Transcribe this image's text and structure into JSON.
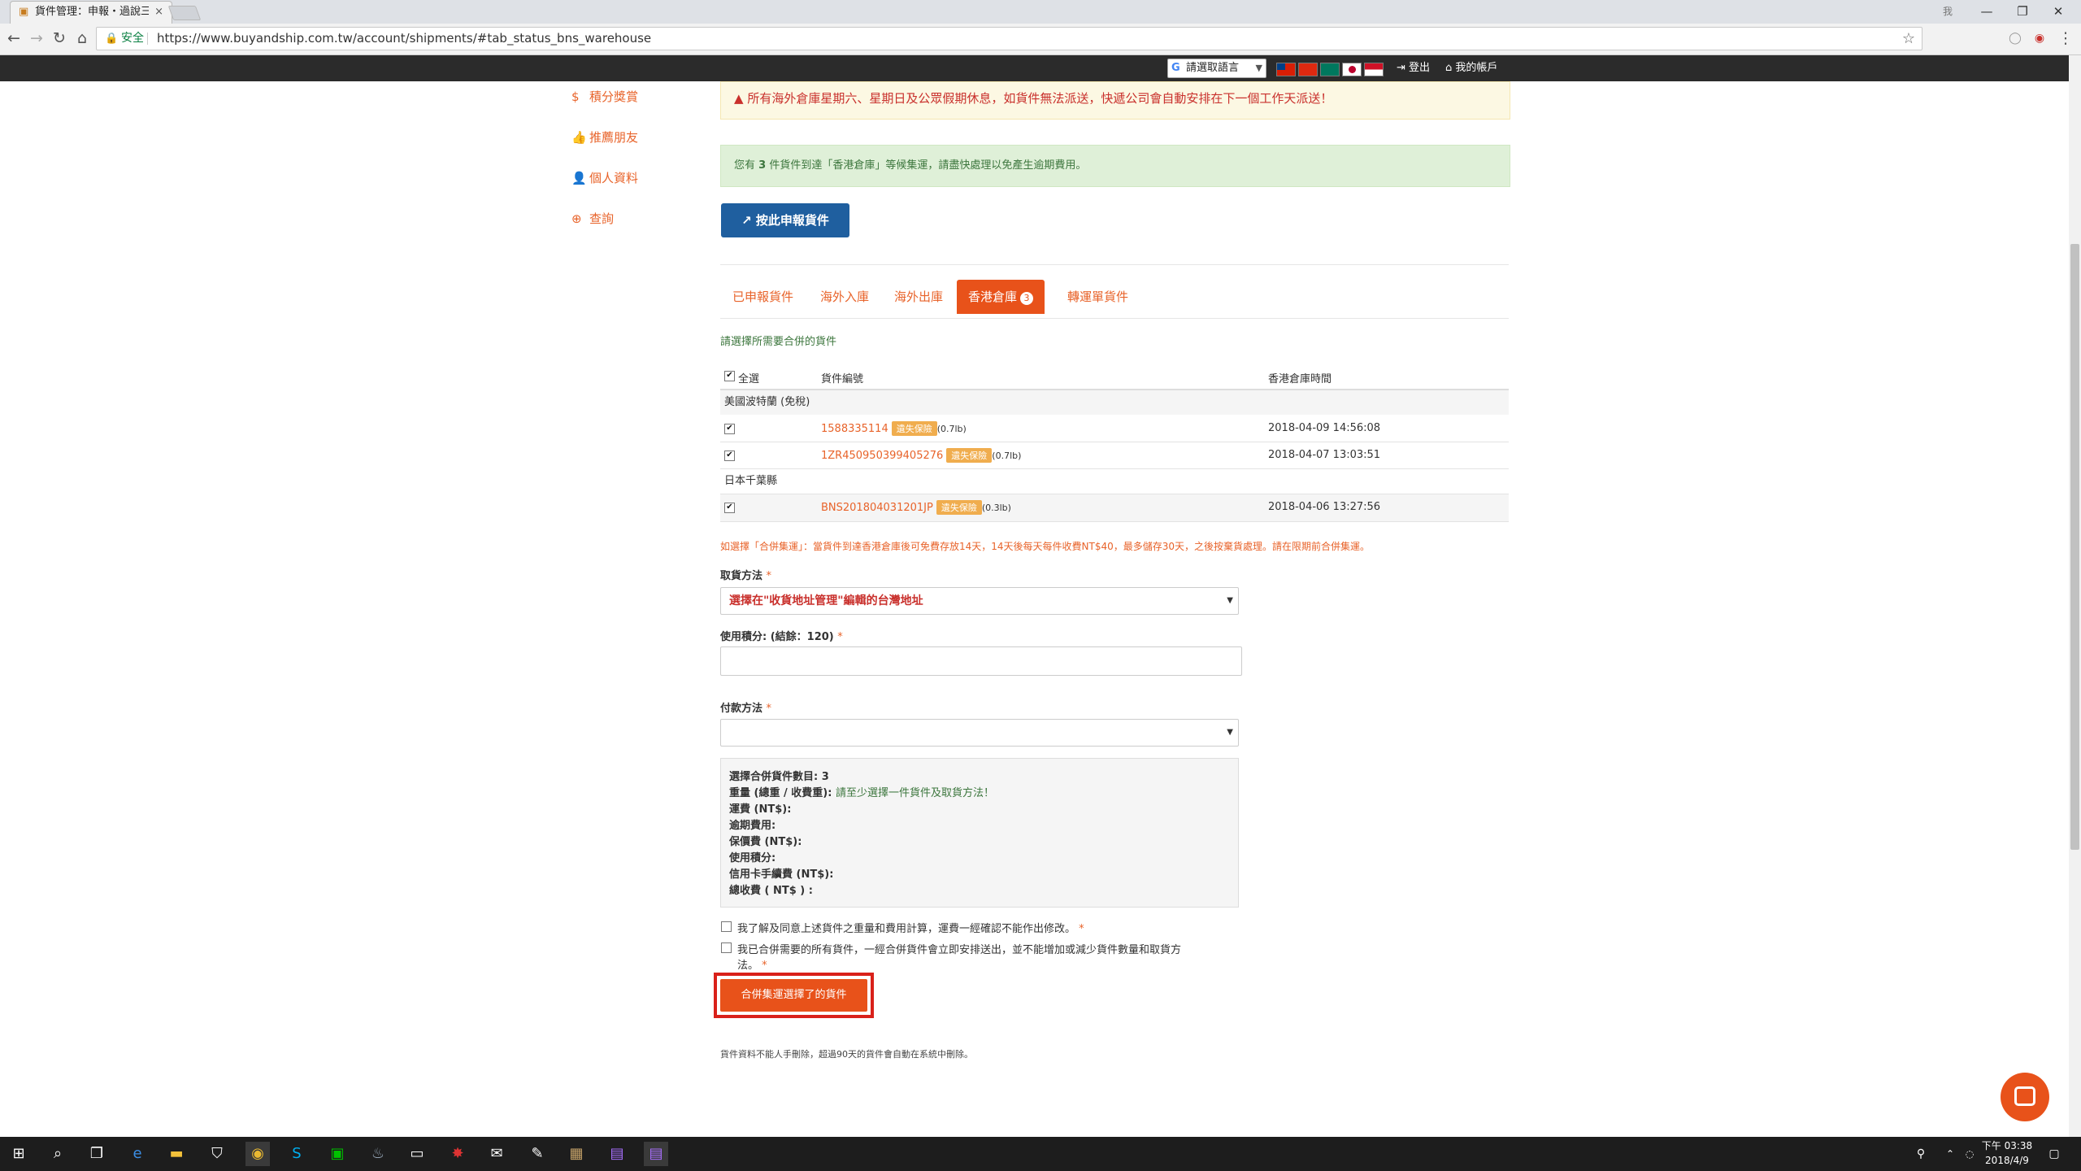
{
  "browser": {
    "tab_title": "貨件管理：申報・過說三",
    "address_secure": "安全",
    "url": "https://www.buyandship.com.tw/account/shipments/#tab_status_bns_warehouse",
    "tab_close": "×",
    "win_user": "我",
    "win_min": "—",
    "win_max": "❐",
    "win_close": "✕"
  },
  "sitebar": {
    "translate_label": "請選取語言",
    "logout": "登出",
    "account": "我的帳戶"
  },
  "sidebar": {
    "items": [
      {
        "icon": "dollar-icon",
        "glyph": "$",
        "label": "積分獎賞"
      },
      {
        "icon": "thumbs-up-icon",
        "glyph": "👍",
        "label": "推薦朋友"
      },
      {
        "icon": "user-icon",
        "glyph": "👤",
        "label": "個人資料"
      },
      {
        "icon": "lifebuoy-icon",
        "glyph": "⊕",
        "label": "查詢"
      }
    ]
  },
  "alerts": {
    "warning": "所有海外倉庫星期六、星期日及公眾假期休息，如貨件無法派送，快遞公司會自動安排在下一個工作天派送！",
    "info_prefix": "您有 ",
    "info_count": "3",
    "info_suffix": " 件貨件到達「香港倉庫」等候集運，請盡快處理以免產生逾期費用。"
  },
  "declare_button": "按此申報貨件",
  "tabs": [
    {
      "label": "已申報貨件"
    },
    {
      "label": "海外入庫"
    },
    {
      "label": "海外出庫"
    },
    {
      "label": "香港倉庫",
      "badge": "3",
      "active": true
    },
    {
      "label": "轉運單貨件"
    }
  ],
  "table": {
    "prompt": "請選擇所需要合併的貨件",
    "headers": {
      "select_all": "全選",
      "tracking": "貨件編號",
      "warehouse_time": "香港倉庫時間"
    },
    "groups": [
      {
        "name": "美國波特蘭 (免稅)",
        "rows": [
          {
            "tracking": "1588335114",
            "insurance": "遺失保險",
            "weight": "(0.7lb)",
            "time": "2018-04-09 14:56:08"
          },
          {
            "tracking": "1ZR450950399405276",
            "insurance": "遺失保險",
            "weight": "(0.7lb)",
            "time": "2018-04-07 13:03:51"
          }
        ]
      },
      {
        "name": "日本千葉縣",
        "rows": [
          {
            "tracking": "BNS201804031201JP",
            "insurance": "遺失保險",
            "weight": "(0.3lb)",
            "time": "2018-04-06 13:27:56"
          }
        ]
      }
    ]
  },
  "form": {
    "merge_note": "如選擇「合併集運」：當貨件到達香港倉庫後可免費存放14天，14天後每天每件收費NT$40，最多儲存30天，之後按棄貨處理。請在限期前合併集運。",
    "pickup_label": "取貨方法",
    "pickup_value": "選擇在\"收貨地址管理\"編輯的台灣地址",
    "points_label": "使用積分: (結餘：120)",
    "points_value": "",
    "payment_label": "付款方法",
    "payment_value": "",
    "required_mark": "*"
  },
  "summary": {
    "count_label": "選擇合併貨件數目:",
    "count_value": "3",
    "weight_label": "重量 (總重 / 收費重):",
    "weight_value": "請至少選擇一件貨件及取貨方法！",
    "shipping": "運費 (NT$):",
    "overdue": "逾期費用:",
    "insurance": "保價費 (NT$):",
    "points": "使用積分:",
    "card_fee": "信用卡手續費 (NT$):",
    "total": "總收費 ( NT$ ) :"
  },
  "agreements": {
    "a1": "我了解及同意上述貨件之重量和費用計算，運費一經確認不能作出修改。",
    "a2_line1": "我已合併需要的所有貨件，一經合併貨件會立即安排送出，並不能增加或減少貨件數量和取貨方",
    "a2_line2": "法。"
  },
  "merge_button": "合併集運選擇了的貨件",
  "footnote": "貨件資料不能人手刪除，超過90天的貨件會自動在系統中刪除。",
  "taskbar": {
    "time": "下午 03:38",
    "date": "2018/4/9"
  },
  "colors": {
    "accent": "#e8521a",
    "link": "#e8632a",
    "primary_button": "#1f5f9f",
    "highlight_frame": "#d9211a"
  }
}
